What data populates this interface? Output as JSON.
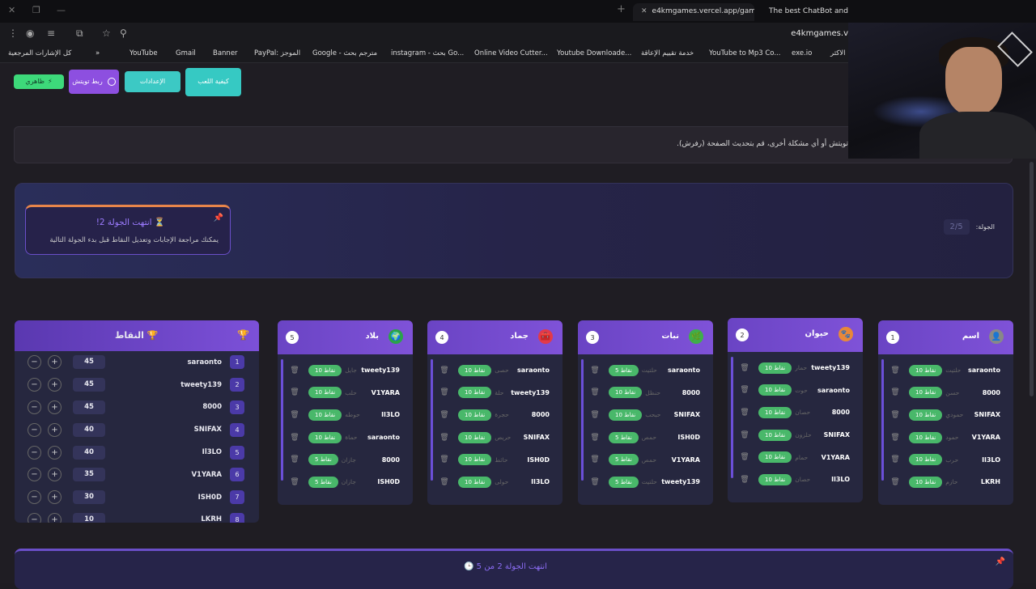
{
  "browser": {
    "tabs": [
      {
        "title": "e4kmgames.vercel.app/games/",
        "active": true
      },
      {
        "title": "The best ChatBot and Wi"
      }
    ],
    "url": "e4kmgames.v",
    "bookmarks": [
      "كل الإشارات المرجعية",
      "YouTube",
      "Gmail",
      "Banner",
      "PayPal: الموجز",
      "Google - مترجم بحث",
      "instagram - بحث Go...",
      "Online Video Cutter...",
      "Youtube Downloade...",
      "خدمة تقييم الإعاقة",
      "YouTube to Mp3 Co...",
      "exe.io",
      "الاكثر"
    ],
    "more": "»"
  },
  "toolbar": {
    "buttons": [
      {
        "label": "كيفية اللعب",
        "color": "#36c9c3"
      },
      {
        "label": "الإعدادات",
        "color": "#3cc9c4"
      },
      {
        "label": "ربط تويتش",
        "color": "#8d4fe0"
      },
      {
        "label": "ظاهري",
        "color": "#3dd97a"
      }
    ]
  },
  "notice": {
    "text": "تويتش أو أي مشكلة أخرى، قم بتحديث الصفحة (رفرش)."
  },
  "round": {
    "title": "انتهت الجولة 2!",
    "subtitle": "يمكنك مراجعة الإجابات وتعديل النقاط قبل بدء الجولة التالية",
    "counter_label": "الجولة:",
    "counter_value": "2/5"
  },
  "scoreboard": {
    "title": "النقاط",
    "rows": [
      {
        "rank": "1",
        "name": "saraonto",
        "points": "45"
      },
      {
        "rank": "2",
        "name": "tweety139",
        "points": "45"
      },
      {
        "rank": "3",
        "name": "8000",
        "points": "45"
      },
      {
        "rank": "4",
        "name": "SNIFAX",
        "points": "40"
      },
      {
        "rank": "5",
        "name": "Il3LO",
        "points": "40"
      },
      {
        "rank": "6",
        "name": "V1YARA",
        "points": "35"
      },
      {
        "rank": "7",
        "name": "ISH0D",
        "points": "30"
      },
      {
        "rank": "8",
        "name": "LKRH",
        "points": "10"
      }
    ]
  },
  "categories": [
    {
      "name": "بلاد",
      "badge": "5",
      "icon_color": "#2aa34a",
      "icon": "🌍",
      "rows": [
        {
          "player": "tweety139",
          "points": "10 نقاط",
          "word": "جايل"
        },
        {
          "player": "V1YARA",
          "points": "10 نقاط",
          "word": "حلب"
        },
        {
          "player": "Il3LO",
          "points": "10 نقاط",
          "word": "حوطه"
        },
        {
          "player": "saraonto",
          "points": "10 نقاط",
          "word": "حماة"
        },
        {
          "player": "8000",
          "points": "5 نقاط",
          "word": "جازان"
        },
        {
          "player": "ISH0D",
          "points": "5 نقاط",
          "word": "جازان"
        }
      ]
    },
    {
      "name": "جماد",
      "badge": "4",
      "icon_color": "#e23a4a",
      "icon": "🧰",
      "rows": [
        {
          "player": "saraonto",
          "points": "10 نقاط",
          "word": "حصى"
        },
        {
          "player": "tweety139",
          "points": "10 نقاط",
          "word": "حلة"
        },
        {
          "player": "8000",
          "points": "10 نقاط",
          "word": "حجرة"
        },
        {
          "player": "SNIFAX",
          "points": "10 نقاط",
          "word": "حريص"
        },
        {
          "player": "ISH0D",
          "points": "10 نقاط",
          "word": "حائط"
        },
        {
          "player": "Il3LO",
          "points": "10 نقاط",
          "word": "حولى"
        }
      ]
    },
    {
      "name": "نبات",
      "badge": "3",
      "icon_color": "#3fae4a",
      "icon": "🌿",
      "rows": [
        {
          "player": "saraonto",
          "points": "5 نقاط",
          "word": "حلتيت"
        },
        {
          "player": "8000",
          "points": "10 نقاط",
          "word": "حنظل"
        },
        {
          "player": "SNIFAX",
          "points": "10 نقاط",
          "word": "حبحب"
        },
        {
          "player": "ISH0D",
          "points": "5 نقاط",
          "word": "حمص"
        },
        {
          "player": "V1YARA",
          "points": "5 نقاط",
          "word": "حمص"
        },
        {
          "player": "tweety139",
          "points": "5 نقاط",
          "word": "حلتيت"
        }
      ]
    },
    {
      "name": "حيوان",
      "badge": "2",
      "icon_color": "#e8883a",
      "icon": "🐾",
      "rows": [
        {
          "player": "tweety139",
          "points": "10 نقاط",
          "word": "حمار"
        },
        {
          "player": "saraonto",
          "points": "10 نقاط",
          "word": "حوت"
        },
        {
          "player": "8000",
          "points": "10 نقاط",
          "word": "حصان"
        },
        {
          "player": "SNIFAX",
          "points": "10 نقاط",
          "word": "حلزون"
        },
        {
          "player": "V1YARA",
          "points": "10 نقاط",
          "word": "حمام"
        },
        {
          "player": "Il3LO",
          "points": "10 نقاط",
          "word": "حصان"
        }
      ]
    },
    {
      "name": "اسم",
      "badge": "1",
      "icon_color": "#888",
      "icon": "👤",
      "rows": [
        {
          "player": "saraonto",
          "points": "10 نقاط",
          "word": "حلتيت"
        },
        {
          "player": "8000",
          "points": "10 نقاط",
          "word": "حسن"
        },
        {
          "player": "SNIFAX",
          "points": "10 نقاط",
          "word": "حمودي"
        },
        {
          "player": "V1YARA",
          "points": "10 نقاط",
          "word": "حمود"
        },
        {
          "player": "Il3LO",
          "points": "10 نقاط",
          "word": "حرب"
        },
        {
          "player": "LKRH",
          "points": "10 نقاط",
          "word": "حازم"
        }
      ]
    }
  ],
  "bottom": {
    "title": "انتهت الجولة 2 من 5"
  }
}
